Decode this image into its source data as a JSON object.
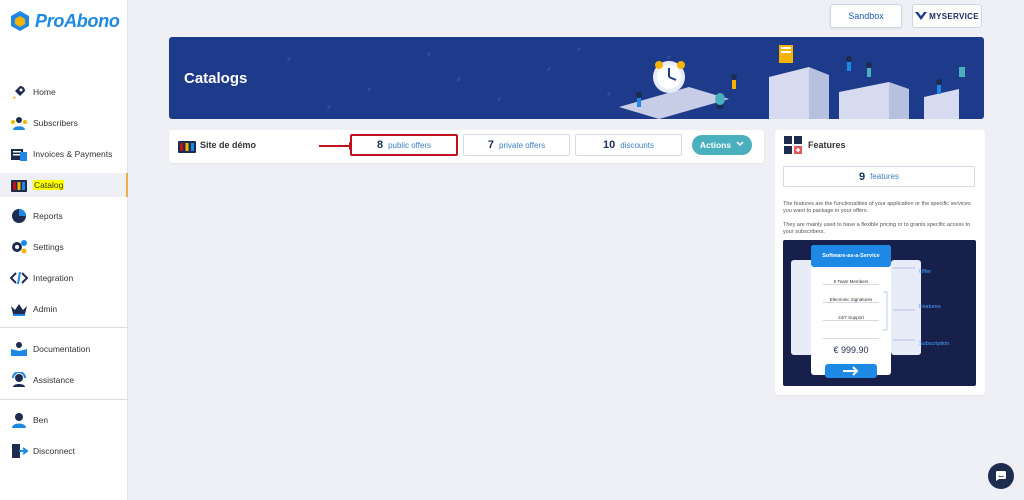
{
  "app": {
    "name": "ProAbono"
  },
  "nav": {
    "items": [
      {
        "label": "Home",
        "icon": "rocket-icon"
      },
      {
        "label": "Subscribers",
        "icon": "users-icon"
      },
      {
        "label": "Invoices & Payments",
        "icon": "invoice-icon"
      },
      {
        "label": "Catalog",
        "icon": "catalog-icon",
        "active": true
      },
      {
        "label": "Reports",
        "icon": "pie-chart-icon"
      },
      {
        "label": "Settings",
        "icon": "gears-icon"
      },
      {
        "label": "Integration",
        "icon": "code-icon"
      },
      {
        "label": "Admin",
        "icon": "crown-icon"
      }
    ],
    "help": [
      {
        "label": "Documentation",
        "icon": "book-icon"
      },
      {
        "label": "Assistance",
        "icon": "headset-icon"
      }
    ],
    "account": [
      {
        "label": "Ben",
        "icon": "user-icon"
      },
      {
        "label": "Disconnect",
        "icon": "logout-icon"
      }
    ]
  },
  "header": {
    "sandbox_label": "Sandbox",
    "service_label": "MYSERVICE"
  },
  "banner": {
    "title": "Catalogs"
  },
  "site": {
    "name": "Site de démo",
    "public_offers": {
      "count": "8",
      "label": "public offers"
    },
    "private_offers": {
      "count": "7",
      "label": "private offers"
    },
    "discounts": {
      "count": "10",
      "label": "discounts"
    },
    "actions_label": "Actions"
  },
  "features": {
    "title": "Features",
    "count": "9",
    "count_label": "features",
    "desc1": "The features are the functionalities of your application or the specific services you want to package in your offers.",
    "desc2": "They are mainly used to have a flexible pricing or to grants specific access to your subscribers.",
    "illustration": {
      "card_title": "Software-as-a-Service",
      "lines": [
        "5 Team Members",
        "Electronic Signatures",
        "24/7 Support"
      ],
      "price": "€ 999.90",
      "side_offer": "Offer",
      "side_features": "Features",
      "side_subscription": "Subscription"
    }
  },
  "colors": {
    "accent": "#1e88e5",
    "banner": "#1e3a8a",
    "highlight": "#c0111f",
    "actions": "#4ab0bd"
  }
}
